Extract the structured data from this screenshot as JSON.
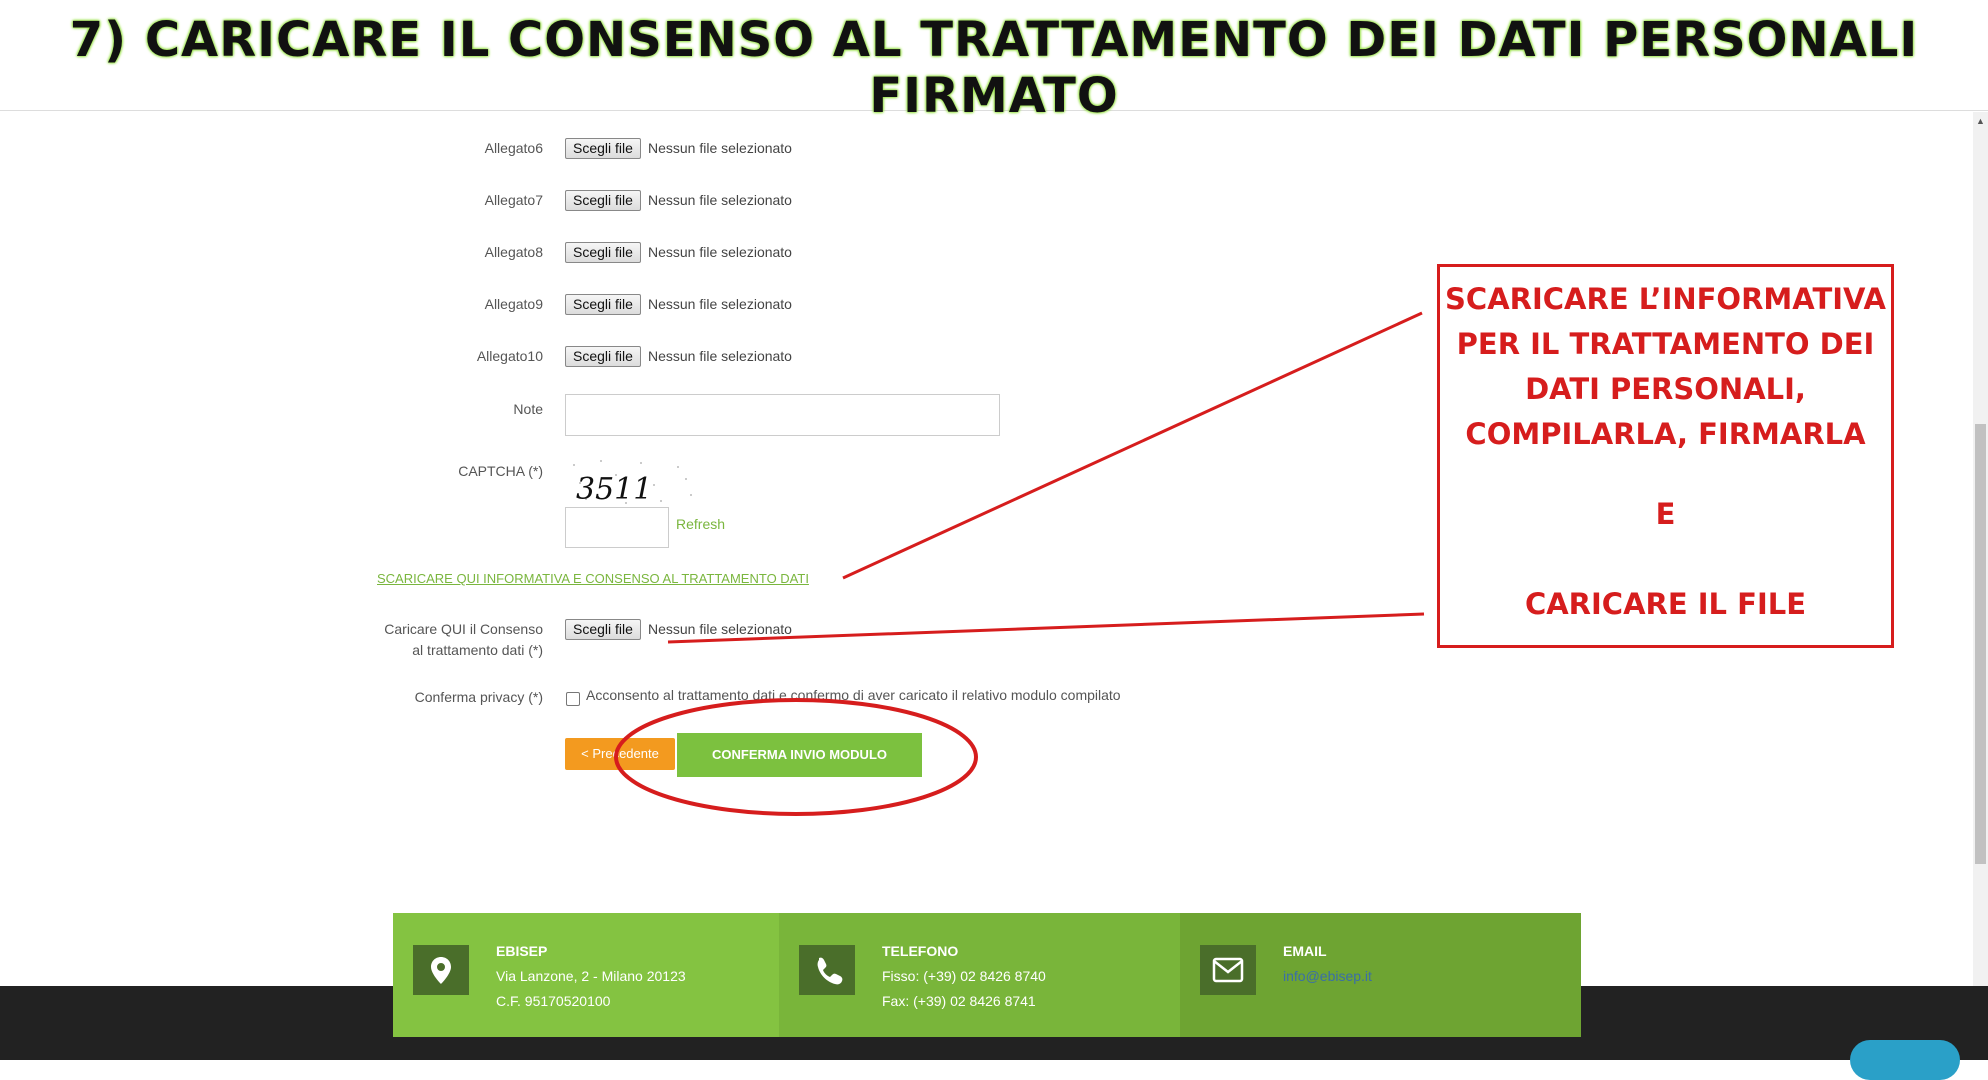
{
  "banner": {
    "title": "7) CARICARE IL CONSENSO AL TRATTAMENTO DEI DATI PERSONALI FIRMATO"
  },
  "form": {
    "file_button_label": "Scegli file",
    "no_file_text": "Nessun file selezionato",
    "attachments": [
      "Allegato6",
      "Allegato7",
      "Allegato8",
      "Allegato9",
      "Allegato10"
    ],
    "note_label": "Note",
    "captcha_label": "CAPTCHA (*)",
    "captcha_value": "3511",
    "refresh_label": "Refresh",
    "download_link": "SCARICARE QUI INFORMATIVA E CONSENSO AL TRATTAMENTO DATI",
    "consent_label_1": "Caricare QUI il Consenso",
    "consent_label_2": "al trattamento dati (*)",
    "privacy_label": "Conferma privacy (*)",
    "privacy_text": "Acconsento al trattamento dati e confermo di aver caricato il relativo modulo compilato",
    "prev_button": "< Precedente",
    "submit_button": "CONFERMA INVIO MODULO"
  },
  "callout": {
    "lines": [
      "SCARICARE L’INFORMATIVA",
      "PER IL TRATTAMENTO DEI",
      "DATI PERSONALI,",
      "COMPILARLA, FIRMARLA"
    ],
    "middle": "E",
    "bottom": "CARICARE IL FILE",
    "color": "#d61d1d"
  },
  "footer": {
    "address": {
      "title": "EBISEP",
      "line1": "Via Lanzone, 2 - Milano 20123",
      "line2": "C.F. 95170520100",
      "icon": "map-marker-icon"
    },
    "phone": {
      "title": "TELEFONO",
      "line1": "Fisso: (+39) 02 8426 8740",
      "line2": "Fax: (+39) 02 8426 8741",
      "icon": "phone-icon"
    },
    "email": {
      "title": "EMAIL",
      "line1": "info@ebisep.it",
      "icon": "envelope-icon"
    }
  },
  "colors": {
    "accent_green": "#7cc13f",
    "orange": "#f39a1f",
    "annotation_red": "#d61d1d"
  }
}
